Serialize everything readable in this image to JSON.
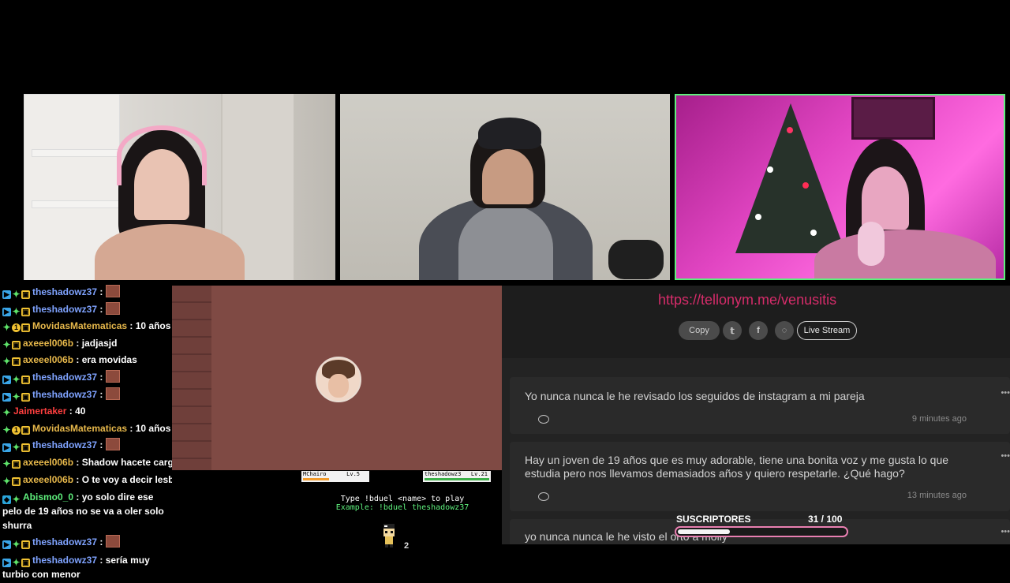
{
  "chat": [
    {
      "badges": [
        "blue",
        "green",
        "gold"
      ],
      "user": "theshadowz37",
      "color": "#7fa3ff",
      "text": "",
      "emote": true
    },
    {
      "badges": [
        "blue",
        "green",
        "gold"
      ],
      "user": "theshadowz37",
      "color": "#7fa3ff",
      "text": "",
      "emote": true
    },
    {
      "badges": [
        "green",
        "one",
        "gold"
      ],
      "user": "MovidasMatematicas",
      "color": "#e7b84b",
      "text": "10 años",
      "emote": false
    },
    {
      "badges": [
        "green",
        "gold"
      ],
      "user": "axeeel006b",
      "color": "#e7b84b",
      "text": "jadjasjd",
      "emote": false
    },
    {
      "badges": [
        "green",
        "gold"
      ],
      "user": "axeeel006b",
      "color": "#e7b84b",
      "text": "era movidas",
      "emote": false
    },
    {
      "badges": [
        "blue",
        "green",
        "gold"
      ],
      "user": "theshadowz37",
      "color": "#7fa3ff",
      "text": "",
      "emote": true
    },
    {
      "badges": [
        "blue",
        "green",
        "gold"
      ],
      "user": "theshadowz37",
      "color": "#7fa3ff",
      "text": "",
      "emote": true
    },
    {
      "badges": [
        "green"
      ],
      "user": "Jaimertaker",
      "color": "#ff3f3f",
      "text": "40",
      "emote": false
    },
    {
      "badges": [
        "green",
        "one",
        "gold"
      ],
      "user": "MovidasMatematicas",
      "color": "#e7b84b",
      "text": "10 años",
      "emote": false
    },
    {
      "badges": [
        "blue",
        "green",
        "gold"
      ],
      "user": "theshadowz37",
      "color": "#7fa3ff",
      "text": "",
      "emote": true
    },
    {
      "badges": [
        "green",
        "gold"
      ],
      "user": "axeeel006b",
      "color": "#e7b84b",
      "text": "Shadow hacete cargo",
      "emote": false
    },
    {
      "badges": [
        "green",
        "gold"
      ],
      "user": "axeeel006b",
      "color": "#e7b84b",
      "text": "O te voy a decir lesbiano",
      "emote": false
    },
    {
      "badges": [
        "cube",
        "green"
      ],
      "user": "Abismo0_0",
      "color": "#5ef07d",
      "text": "yo solo dire ese pelo de 19 años no se va a oler solo shurra",
      "emote": false,
      "wrap": true
    },
    {
      "badges": [
        "blue",
        "green",
        "gold"
      ],
      "user": "theshadowz37",
      "color": "#7fa3ff",
      "text": "",
      "emote": true
    },
    {
      "badges": [
        "blue",
        "green",
        "gold"
      ],
      "user": "theshadowz37",
      "color": "#7fa3ff",
      "text": "sería muy turbio con menor",
      "emote": false,
      "wrap": true
    }
  ],
  "game": {
    "player1_name": "MChairo",
    "player1_level": "Lv.5",
    "player1_hp": 0.4,
    "player2_name": "theshadowz3",
    "player2_level": "Lv.21",
    "player2_hp": 1.0,
    "instruction": "Type !bduel <name> to play",
    "example": "Example: !bduel theshadowz37",
    "char_counter": "2"
  },
  "panel": {
    "link": "https://tellonym.me/venusitis",
    "share": {
      "copy": "Copy",
      "live": "Live Stream",
      "icons": [
        "twitter-icon",
        "facebook-icon",
        "whatsapp-icon"
      ]
    },
    "questions": [
      {
        "text": "Yo nunca nunca le he revisado los seguidos de instagram a mi pareja",
        "time": "9 minutes ago"
      },
      {
        "text": "Hay un joven de 19 años que es muy adorable, tiene una bonita voz y me gusta lo que estudia pero nos llevamos demasiados años y quiero respetarle. ¿Qué hago?",
        "time": "13 minutes ago"
      },
      {
        "text": "yo nunca nunca le he visto el orto a molly",
        "time": ""
      }
    ]
  },
  "subs": {
    "label": "SUSCRIPTORES",
    "current": 31,
    "goal": 100,
    "count_text": "31  / 100"
  },
  "colors": {
    "accent": "#d62c6a",
    "cam_border": "#5ef07d",
    "subs_border": "#e97fb1"
  }
}
